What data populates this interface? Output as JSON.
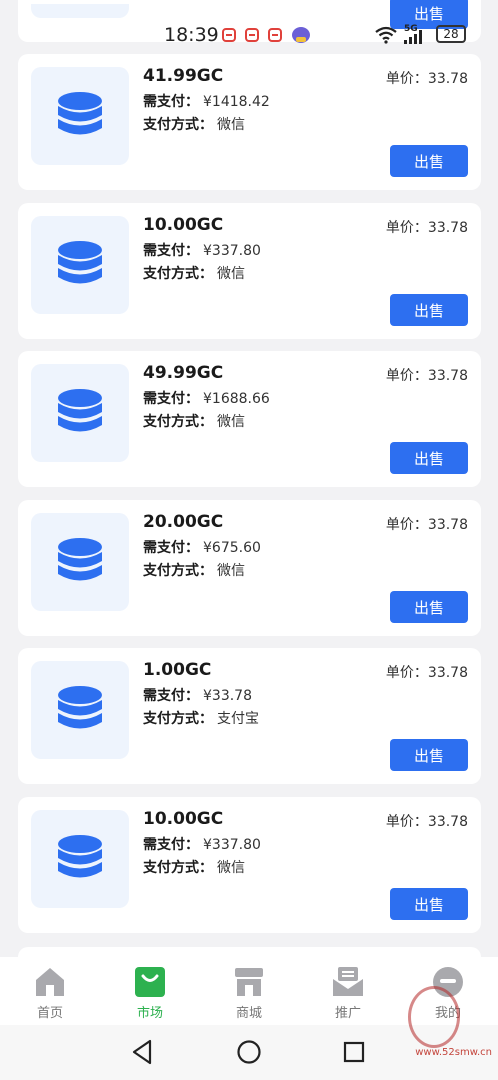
{
  "status_bar": {
    "time": "18:39",
    "network": "5G",
    "battery": "28"
  },
  "partial_top_card": {
    "sell_label": "出售"
  },
  "orders": [
    {
      "amount": "41.99GC",
      "pay_label": "需支付：",
      "pay_value": "¥1418.42",
      "method_label": "支付方式：",
      "method_value": "微信",
      "price_label": "单价：",
      "price_value": "33.78",
      "sell_label": "出售"
    },
    {
      "amount": "10.00GC",
      "pay_label": "需支付：",
      "pay_value": "¥337.80",
      "method_label": "支付方式：",
      "method_value": "微信",
      "price_label": "单价：",
      "price_value": "33.78",
      "sell_label": "出售"
    },
    {
      "amount": "49.99GC",
      "pay_label": "需支付：",
      "pay_value": "¥1688.66",
      "method_label": "支付方式：",
      "method_value": "微信",
      "price_label": "单价：",
      "price_value": "33.78",
      "sell_label": "出售"
    },
    {
      "amount": "20.00GC",
      "pay_label": "需支付：",
      "pay_value": "¥675.60",
      "method_label": "支付方式：",
      "method_value": "微信",
      "price_label": "单价：",
      "price_value": "33.78",
      "sell_label": "出售"
    },
    {
      "amount": "1.00GC",
      "pay_label": "需支付：",
      "pay_value": "¥33.78",
      "method_label": "支付方式：",
      "method_value": "支付宝",
      "price_label": "单价：",
      "price_value": "33.78",
      "sell_label": "出售"
    },
    {
      "amount": "10.00GC",
      "pay_label": "需支付：",
      "pay_value": "¥337.80",
      "method_label": "支付方式：",
      "method_value": "微信",
      "price_label": "单价：",
      "price_value": "33.78",
      "sell_label": "出售"
    }
  ],
  "tabbar": {
    "items": [
      {
        "label": "首页",
        "icon": "home-icon",
        "active": false
      },
      {
        "label": "市场",
        "icon": "shopping-bag-icon",
        "active": true
      },
      {
        "label": "商城",
        "icon": "store-icon",
        "active": false
      },
      {
        "label": "推广",
        "icon": "mail-icon",
        "active": false
      },
      {
        "label": "我的",
        "icon": "profile-icon",
        "active": false
      }
    ]
  },
  "colors": {
    "primary": "#2d6ff0",
    "active_tab": "#2db14f",
    "icon_bg": "#eef4fd",
    "page_bg": "#f2f2f4"
  },
  "watermark": {
    "url": "www.52smw.cn"
  }
}
